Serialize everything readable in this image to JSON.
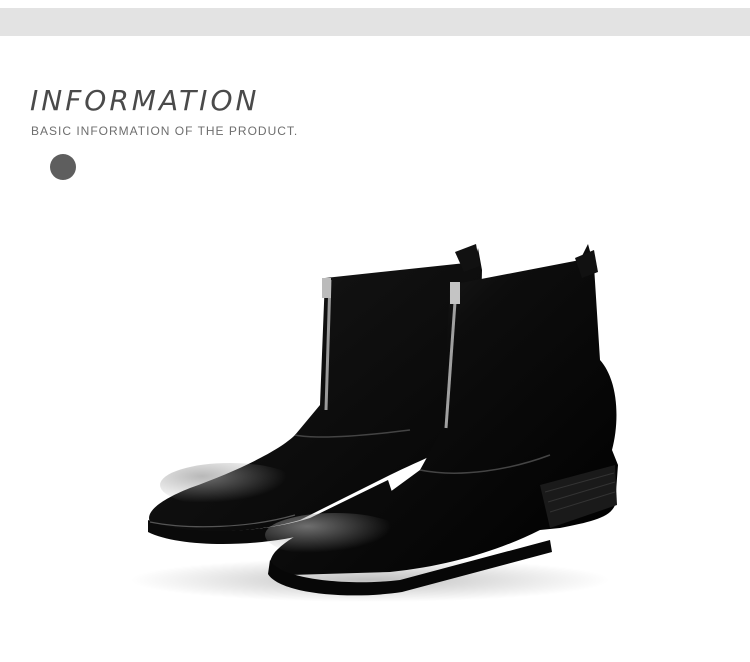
{
  "section": {
    "title": "INFORMATION",
    "subtitle": "BASIC INFORMATION OF THE PRODUCT."
  },
  "colors": {
    "header_band": "#e3e3e3",
    "title_text": "#4a4a4a",
    "subtitle_text": "#6e6e6e",
    "dot": "#5e5e5e",
    "boot_leather": "#111111"
  },
  "product": {
    "icon": "zip-ankle-boots-image"
  }
}
